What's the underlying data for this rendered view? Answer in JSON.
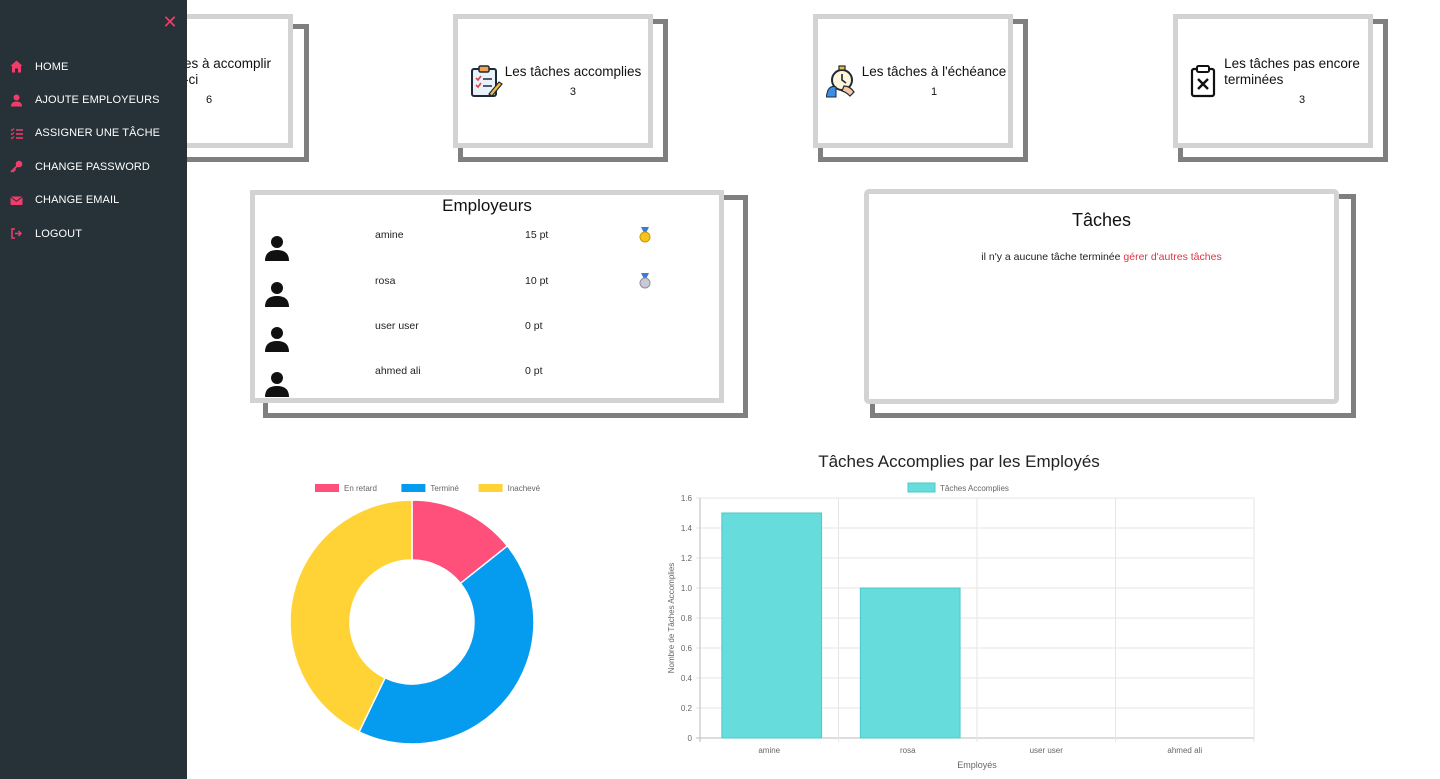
{
  "sidebar": {
    "close_label": "✕",
    "items": [
      {
        "label": "HOME",
        "icon": "home-icon"
      },
      {
        "label": "AJOUTE EMPLOYEURS",
        "icon": "user-icon"
      },
      {
        "label": "ASSIGNER UNE TÂCHE",
        "icon": "task-list-icon"
      },
      {
        "label": "CHANGE PASSWORD",
        "icon": "key-icon"
      },
      {
        "label": "CHANGE EMAIL",
        "icon": "envelope-icon"
      },
      {
        "label": "LOGOUT",
        "icon": "logout-icon"
      }
    ],
    "accent": "#f23c6a",
    "background": "#263238"
  },
  "stats": [
    {
      "title_line1": "es à accomplir",
      "title_line2": "-ci",
      "count": "6",
      "icon": "none"
    },
    {
      "title_line1": "Les tâches accomplies",
      "title_line2": "",
      "count": "3",
      "icon": "clipboard-check-icon"
    },
    {
      "title_line1": "Les tâches à l'échéance",
      "title_line2": "",
      "count": "1",
      "icon": "stopwatch-hand-icon"
    },
    {
      "title_line1": "Les tâches pas encore",
      "title_line2": "terminées",
      "count": "3",
      "icon": "clipboard-x-icon"
    }
  ],
  "employeurs": {
    "title": "Employeurs",
    "rows": [
      {
        "name": "amine",
        "points": "15 pt",
        "medal": "gold"
      },
      {
        "name": "rosa",
        "points": "10 pt",
        "medal": "silver"
      },
      {
        "name": "user user",
        "points": "0 pt",
        "medal": ""
      },
      {
        "name": "ahmed ali",
        "points": "0 pt",
        "medal": ""
      }
    ]
  },
  "taches": {
    "title": "Tâches",
    "message": "il n'y a aucune tâche terminée",
    "link": "gérer d'autres tâches"
  },
  "chart_data": [
    {
      "type": "pie",
      "labels": [
        "En retard",
        "Terminé",
        "Inachevé"
      ],
      "values": [
        1,
        3,
        3
      ],
      "colors": [
        "#ff4f7b",
        "#059bef",
        "#ffd236"
      ],
      "legend": "top"
    },
    {
      "type": "bar",
      "title": "Tâches Accomplies par les Employés",
      "categories": [
        "amine",
        "rosa",
        "user user",
        "ahmed ali"
      ],
      "series": [
        {
          "name": "Tâches Accomplies",
          "values": [
            1.5,
            1.0,
            0,
            0
          ]
        }
      ],
      "xlabel": "Employés",
      "ylabel": "Nombre de Tâches Accomplies",
      "ylim": [
        0,
        1.6
      ],
      "yticks": [
        "0",
        "0.2",
        "0.4",
        "0.6",
        "0.8",
        "1.0",
        "1.2",
        "1.4",
        "1.6"
      ],
      "color": "#67dcdc",
      "grid": true,
      "legend": "top"
    }
  ]
}
